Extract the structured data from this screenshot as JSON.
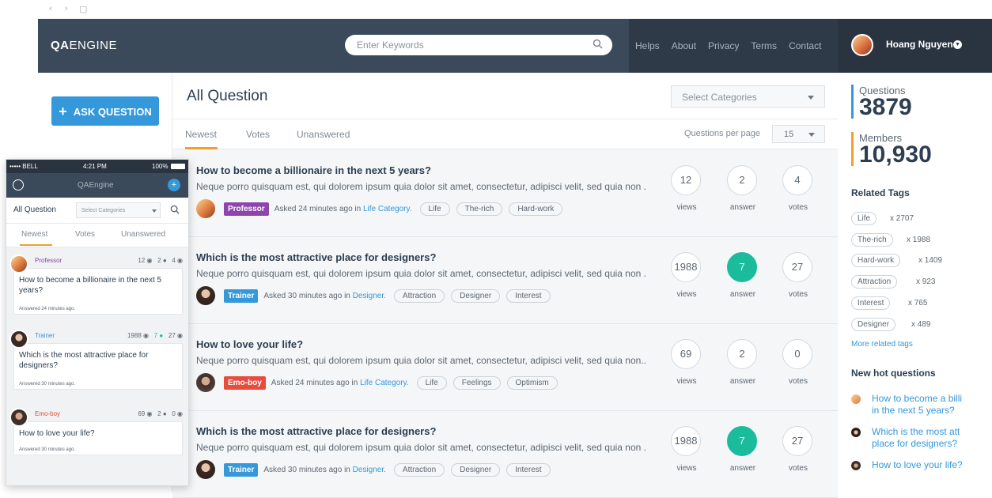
{
  "browser": {
    "back": "‹",
    "forward": "›",
    "tab_icon": "▢"
  },
  "header": {
    "logo_bold": "QA",
    "logo_rest": "ENGINE",
    "search_placeholder": "Enter Keywords",
    "nav": [
      "Helps",
      "About",
      "Privacy",
      "Terms",
      "Contact"
    ],
    "user_name": "Hoang Nguyen"
  },
  "sidebar": {
    "ask_label": "ASK QUESTION"
  },
  "main": {
    "title": "All Question",
    "category_select": "Select Categories",
    "tabs": [
      "Newest",
      "Votes",
      "Unanswered"
    ],
    "per_page_label": "Questions per page",
    "per_page_value": "15",
    "questions": [
      {
        "title": "How to become a billionaire in the next 5 years?",
        "excerpt": "Neque porro quisquam est, qui dolorem ipsum quia dolor sit amet, consectetur, adipisci velit, sed quia non ...",
        "badge": "Professor",
        "badge_color": "#8e44ad",
        "asked": "Asked 24 minutes ago in",
        "category": "Life Category.",
        "tags": [
          "Life",
          "The-rich",
          "Hard-work"
        ],
        "views": "12",
        "answers": "2",
        "votes": "4",
        "answered": false
      },
      {
        "title": "Which is the most attractive place for designers?",
        "excerpt": "Neque porro quisquam est, qui dolorem ipsum quia dolor sit amet, consectetur, adipisci velit, sed quia non ...",
        "badge": "Trainer",
        "badge_color": "#3498db",
        "asked": "Asked 30 minutes ago in",
        "category": "Designer.",
        "tags": [
          "Attraction",
          "Designer",
          "Interest"
        ],
        "views": "1988",
        "answers": "7",
        "votes": "27",
        "answered": true
      },
      {
        "title": "How to love your life?",
        "excerpt": "Neque porro quisquam est, qui dolorem ipsum quia dolor sit amet, consectetur, adipisci velit, sed quia non...",
        "badge": "Emo-boy",
        "badge_color": "#e74c3c",
        "asked": "Asked 24 minutes ago in",
        "category": "Life Category.",
        "tags": [
          "Life",
          "Feelings",
          "Optimism"
        ],
        "views": "69",
        "answers": "2",
        "votes": "0",
        "answered": false
      },
      {
        "title": "Which is the most attractive place for designers?",
        "excerpt": "Neque porro quisquam est, qui dolorem ipsum quia dolor sit amet, consectetur, adipisci velit, sed quia non ...",
        "badge": "Trainer",
        "badge_color": "#3498db",
        "asked": "Asked 30 minutes ago in",
        "category": "Designer.",
        "tags": [
          "Attraction",
          "Designer",
          "Interest"
        ],
        "views": "1988",
        "answers": "7",
        "votes": "27",
        "answered": true
      }
    ],
    "stat_labels": {
      "views": "views",
      "answers": "answer",
      "votes": "votes"
    }
  },
  "right": {
    "questions_label": "Questions",
    "questions_value": "3879",
    "members_label": "Members",
    "members_value": "10,930",
    "related_title": "Related Tags",
    "tags": [
      {
        "name": "Life",
        "count": "x 2707"
      },
      {
        "name": "The-rich",
        "count": "x 1988"
      },
      {
        "name": "Hard-work",
        "count": "x 1409"
      },
      {
        "name": "Attraction",
        "count": "x 923"
      },
      {
        "name": "Interest",
        "count": "x 765"
      },
      {
        "name": "Designer",
        "count": "x 489"
      }
    ],
    "more_tags": "More related tags",
    "hot_title": "New hot questions",
    "hot": [
      "How to become a billi in the next 5 years?",
      "Which is the most att place for designers?",
      "How to love your life?"
    ]
  },
  "phone": {
    "carrier": "••••• BELL",
    "time": "4:21 PM",
    "battery": "100%",
    "app_title": "QAEngine",
    "all_question": "All Question",
    "select": "Select Categories",
    "tabs": [
      "Newest",
      "Votes",
      "Unanswered"
    ],
    "items": [
      {
        "role": "Professor",
        "color": "#8e44ad",
        "views": "12",
        "answers": "2",
        "votes": "4",
        "question": "How to become a billionaire in the next 5 years?",
        "answered": "Answered 24 minutes ago."
      },
      {
        "role": "Trainer",
        "color": "#3498db",
        "views": "1988",
        "answers": "7",
        "votes": "27",
        "question": "Which is the most attractive place for designers?",
        "answered": "Answered 30 minutes ago."
      },
      {
        "role": "Emo-boy",
        "color": "#e74c3c",
        "views": "69",
        "answers": "2",
        "votes": "0",
        "question": "How to love your life?",
        "answered": "Answered 30 minutes ago."
      }
    ]
  },
  "colors": {
    "accent": "#3498db",
    "tab_underline": "#f0a030",
    "answered": "#1abc9c",
    "nav_bg": "#3b4a5a"
  }
}
